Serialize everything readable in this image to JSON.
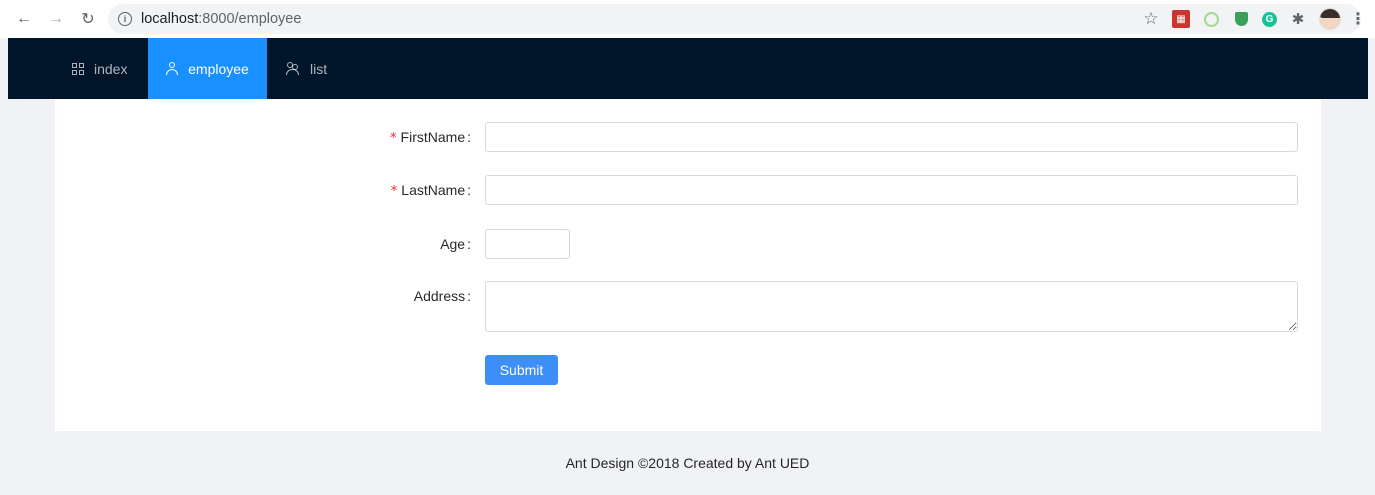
{
  "browser": {
    "url_host": "localhost",
    "url_path": ":8000/employee",
    "icons": [
      "back-arrow-icon",
      "forward-arrow-icon",
      "reload-icon",
      "info-icon",
      "star-icon",
      "extension-icons",
      "puzzle-icon",
      "avatar",
      "kebab-menu-icon"
    ]
  },
  "header": {
    "menu": [
      {
        "label": "index",
        "icon": "appstore-icon",
        "active": false
      },
      {
        "label": "employee",
        "icon": "user-icon",
        "active": true
      },
      {
        "label": "list",
        "icon": "team-icon",
        "active": false
      }
    ],
    "background": "#001529",
    "active_color": "#1890ff"
  },
  "form": {
    "first_name": {
      "label": "FirstName",
      "required": true,
      "value": ""
    },
    "last_name": {
      "label": "LastName",
      "required": true,
      "value": ""
    },
    "age": {
      "label": "Age",
      "required": false,
      "value": ""
    },
    "address": {
      "label": "Address",
      "required": false,
      "value": ""
    },
    "submit_label": "Submit",
    "required_mark": "*",
    "colon": ":"
  },
  "footer": {
    "text": "Ant Design ©2018 Created by Ant UED"
  }
}
